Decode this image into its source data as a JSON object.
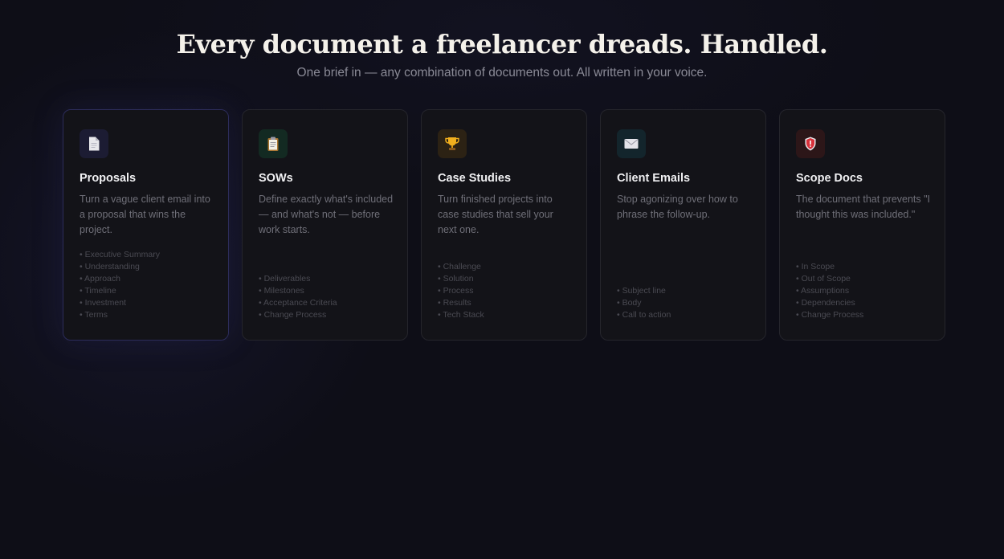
{
  "header": {
    "title": "Every document a freelancer dreads. Handled.",
    "subtitle": "One brief in — any combination of documents out. All written in your voice."
  },
  "cards": [
    {
      "icon": "document-icon",
      "icon_bg": "#1c1c33",
      "title": "Proposals",
      "description": "Turn a vague client email into a proposal that wins the project.",
      "sections": [
        "Executive Summary",
        "Understanding",
        "Approach",
        "Timeline",
        "Investment",
        "Terms"
      ]
    },
    {
      "icon": "clipboard-icon",
      "icon_bg": "#132a22",
      "title": "SOWs",
      "description": "Define exactly what's included — and what's not — before work starts.",
      "sections": [
        "Deliverables",
        "Milestones",
        "Acceptance Criteria",
        "Change Process"
      ]
    },
    {
      "icon": "trophy-icon",
      "icon_bg": "#2c2214",
      "title": "Case Studies",
      "description": "Turn finished projects into case studies that sell your next one.",
      "sections": [
        "Challenge",
        "Solution",
        "Process",
        "Results",
        "Tech Stack"
      ]
    },
    {
      "icon": "envelope-icon",
      "icon_bg": "#13252c",
      "title": "Client Emails",
      "description": "Stop agonizing over how to phrase the follow-up.",
      "sections": [
        "Subject line",
        "Body",
        "Call to action"
      ]
    },
    {
      "icon": "shield-icon",
      "icon_bg": "#2c1618",
      "title": "Scope Docs",
      "description": "The document that prevents \"I thought this was included.\"",
      "sections": [
        "In Scope",
        "Out of Scope",
        "Assumptions",
        "Dependencies",
        "Change Process"
      ]
    }
  ]
}
